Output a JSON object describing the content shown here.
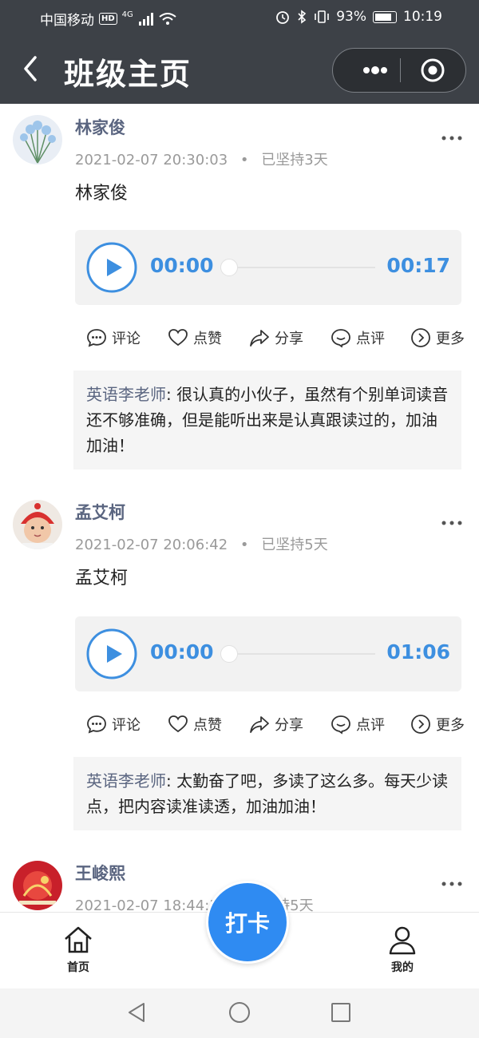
{
  "status_bar": {
    "carrier": "中国移动",
    "hd": "HD",
    "network": "4G",
    "battery": "93%",
    "time": "10:19"
  },
  "nav": {
    "title": "班级主页"
  },
  "posts": [
    {
      "name": "林家俊",
      "time": "2021-02-07 20:30:03",
      "streak": "已坚持3天",
      "content": "林家俊",
      "audio": {
        "current": "00:00",
        "duration": "00:17"
      },
      "comment": {
        "author": "英语李老师",
        "text": "很认真的小伙子，虽然有个别单词读音还不够准确，但是能听出来是认真跟读过的，加油加油！"
      }
    },
    {
      "name": "孟艾柯",
      "time": "2021-02-07 20:06:42",
      "streak": "已坚持5天",
      "content": "孟艾柯",
      "audio": {
        "current": "00:00",
        "duration": "01:06"
      },
      "comment": {
        "author": "英语李老师",
        "text": "太勤奋了吧，多读了这么多。每天少读点，把内容读准读透，加油加油！"
      }
    },
    {
      "name": "王峻熙",
      "time": "2021-02-07 18:44:3",
      "streak": "持5天"
    }
  ],
  "actions": {
    "comment": "评论",
    "like": "点赞",
    "share": "分享",
    "review": "点评",
    "more": "更多"
  },
  "fab": {
    "label": "打卡"
  },
  "tabs": {
    "home": "首页",
    "mine": "我的"
  },
  "colors": {
    "accent": "#3d8fe0",
    "fab": "#2f8bf2",
    "header": "#3d4147",
    "username": "#5a6580"
  },
  "icons": [
    "back-icon",
    "more-dots-icon",
    "target-icon",
    "play-icon",
    "comment-icon",
    "heart-icon",
    "share-icon",
    "review-icon",
    "more-arrow-icon",
    "home-icon",
    "user-icon",
    "triangle-back-icon",
    "circle-home-icon",
    "square-recent-icon"
  ]
}
